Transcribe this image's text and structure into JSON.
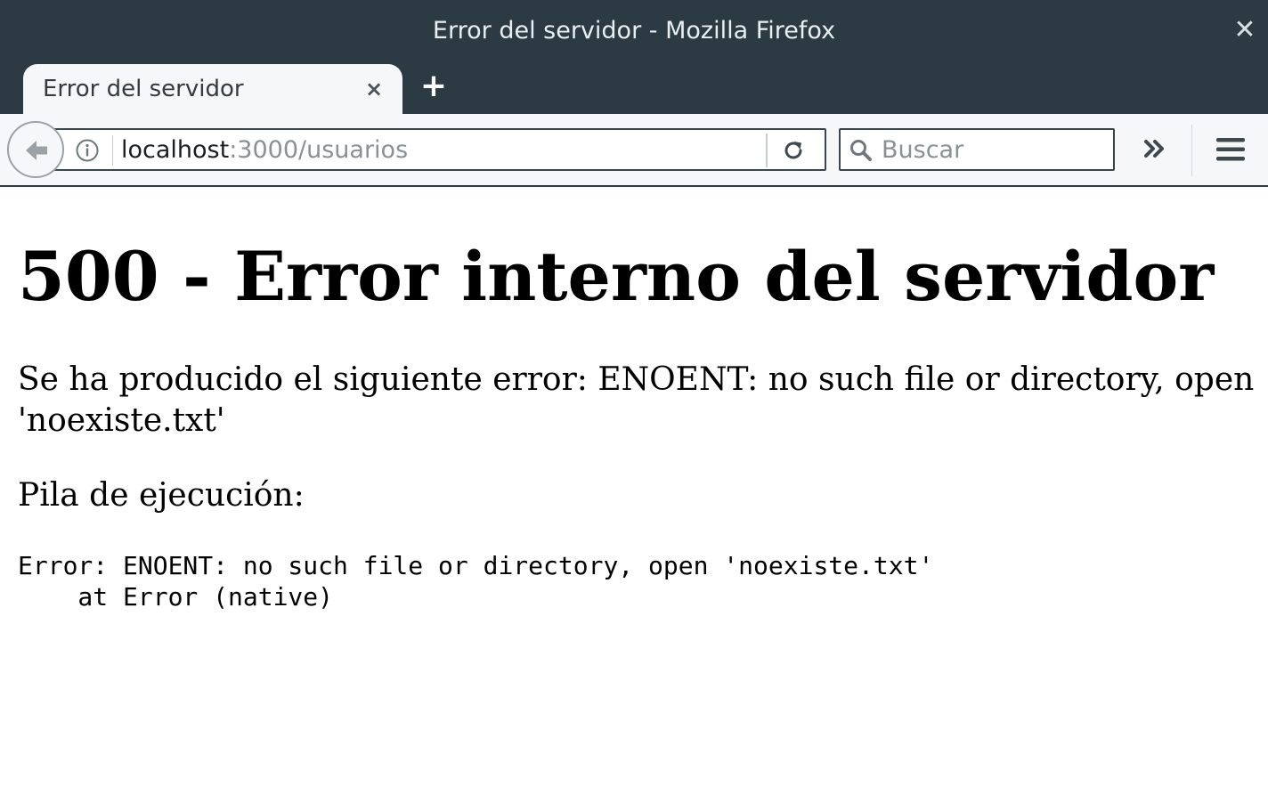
{
  "window": {
    "title": "Error del servidor - Mozilla Firefox",
    "close_icon": "close-icon"
  },
  "tabs": [
    {
      "title": "Error del servidor",
      "active": true
    }
  ],
  "tab_close_glyph": "×",
  "close_glyph": "✕",
  "new_tab_glyph": "+",
  "toolbar": {
    "url_host": "localhost",
    "url_rest": ":3000/usuarios",
    "search_placeholder": "Buscar",
    "icons": [
      "back-arrow-icon",
      "info-icon",
      "reload-icon",
      "search-icon",
      "overflow-chevron-icon",
      "hamburger-menu-icon"
    ]
  },
  "page": {
    "heading": "500 - Error interno del servidor",
    "message": "Se ha producido el siguiente error: ENOENT: no such file or directory, open 'noexiste.txt'",
    "stack_label": "Pila de ejecución:",
    "stack_trace": "Error: ENOENT: no such file or directory, open 'noexiste.txt'\n    at Error (native)"
  },
  "colors": {
    "chrome_dark": "#2b3a43",
    "toolbar_bg": "#f6f7f8",
    "url_gray": "#8a9196"
  }
}
